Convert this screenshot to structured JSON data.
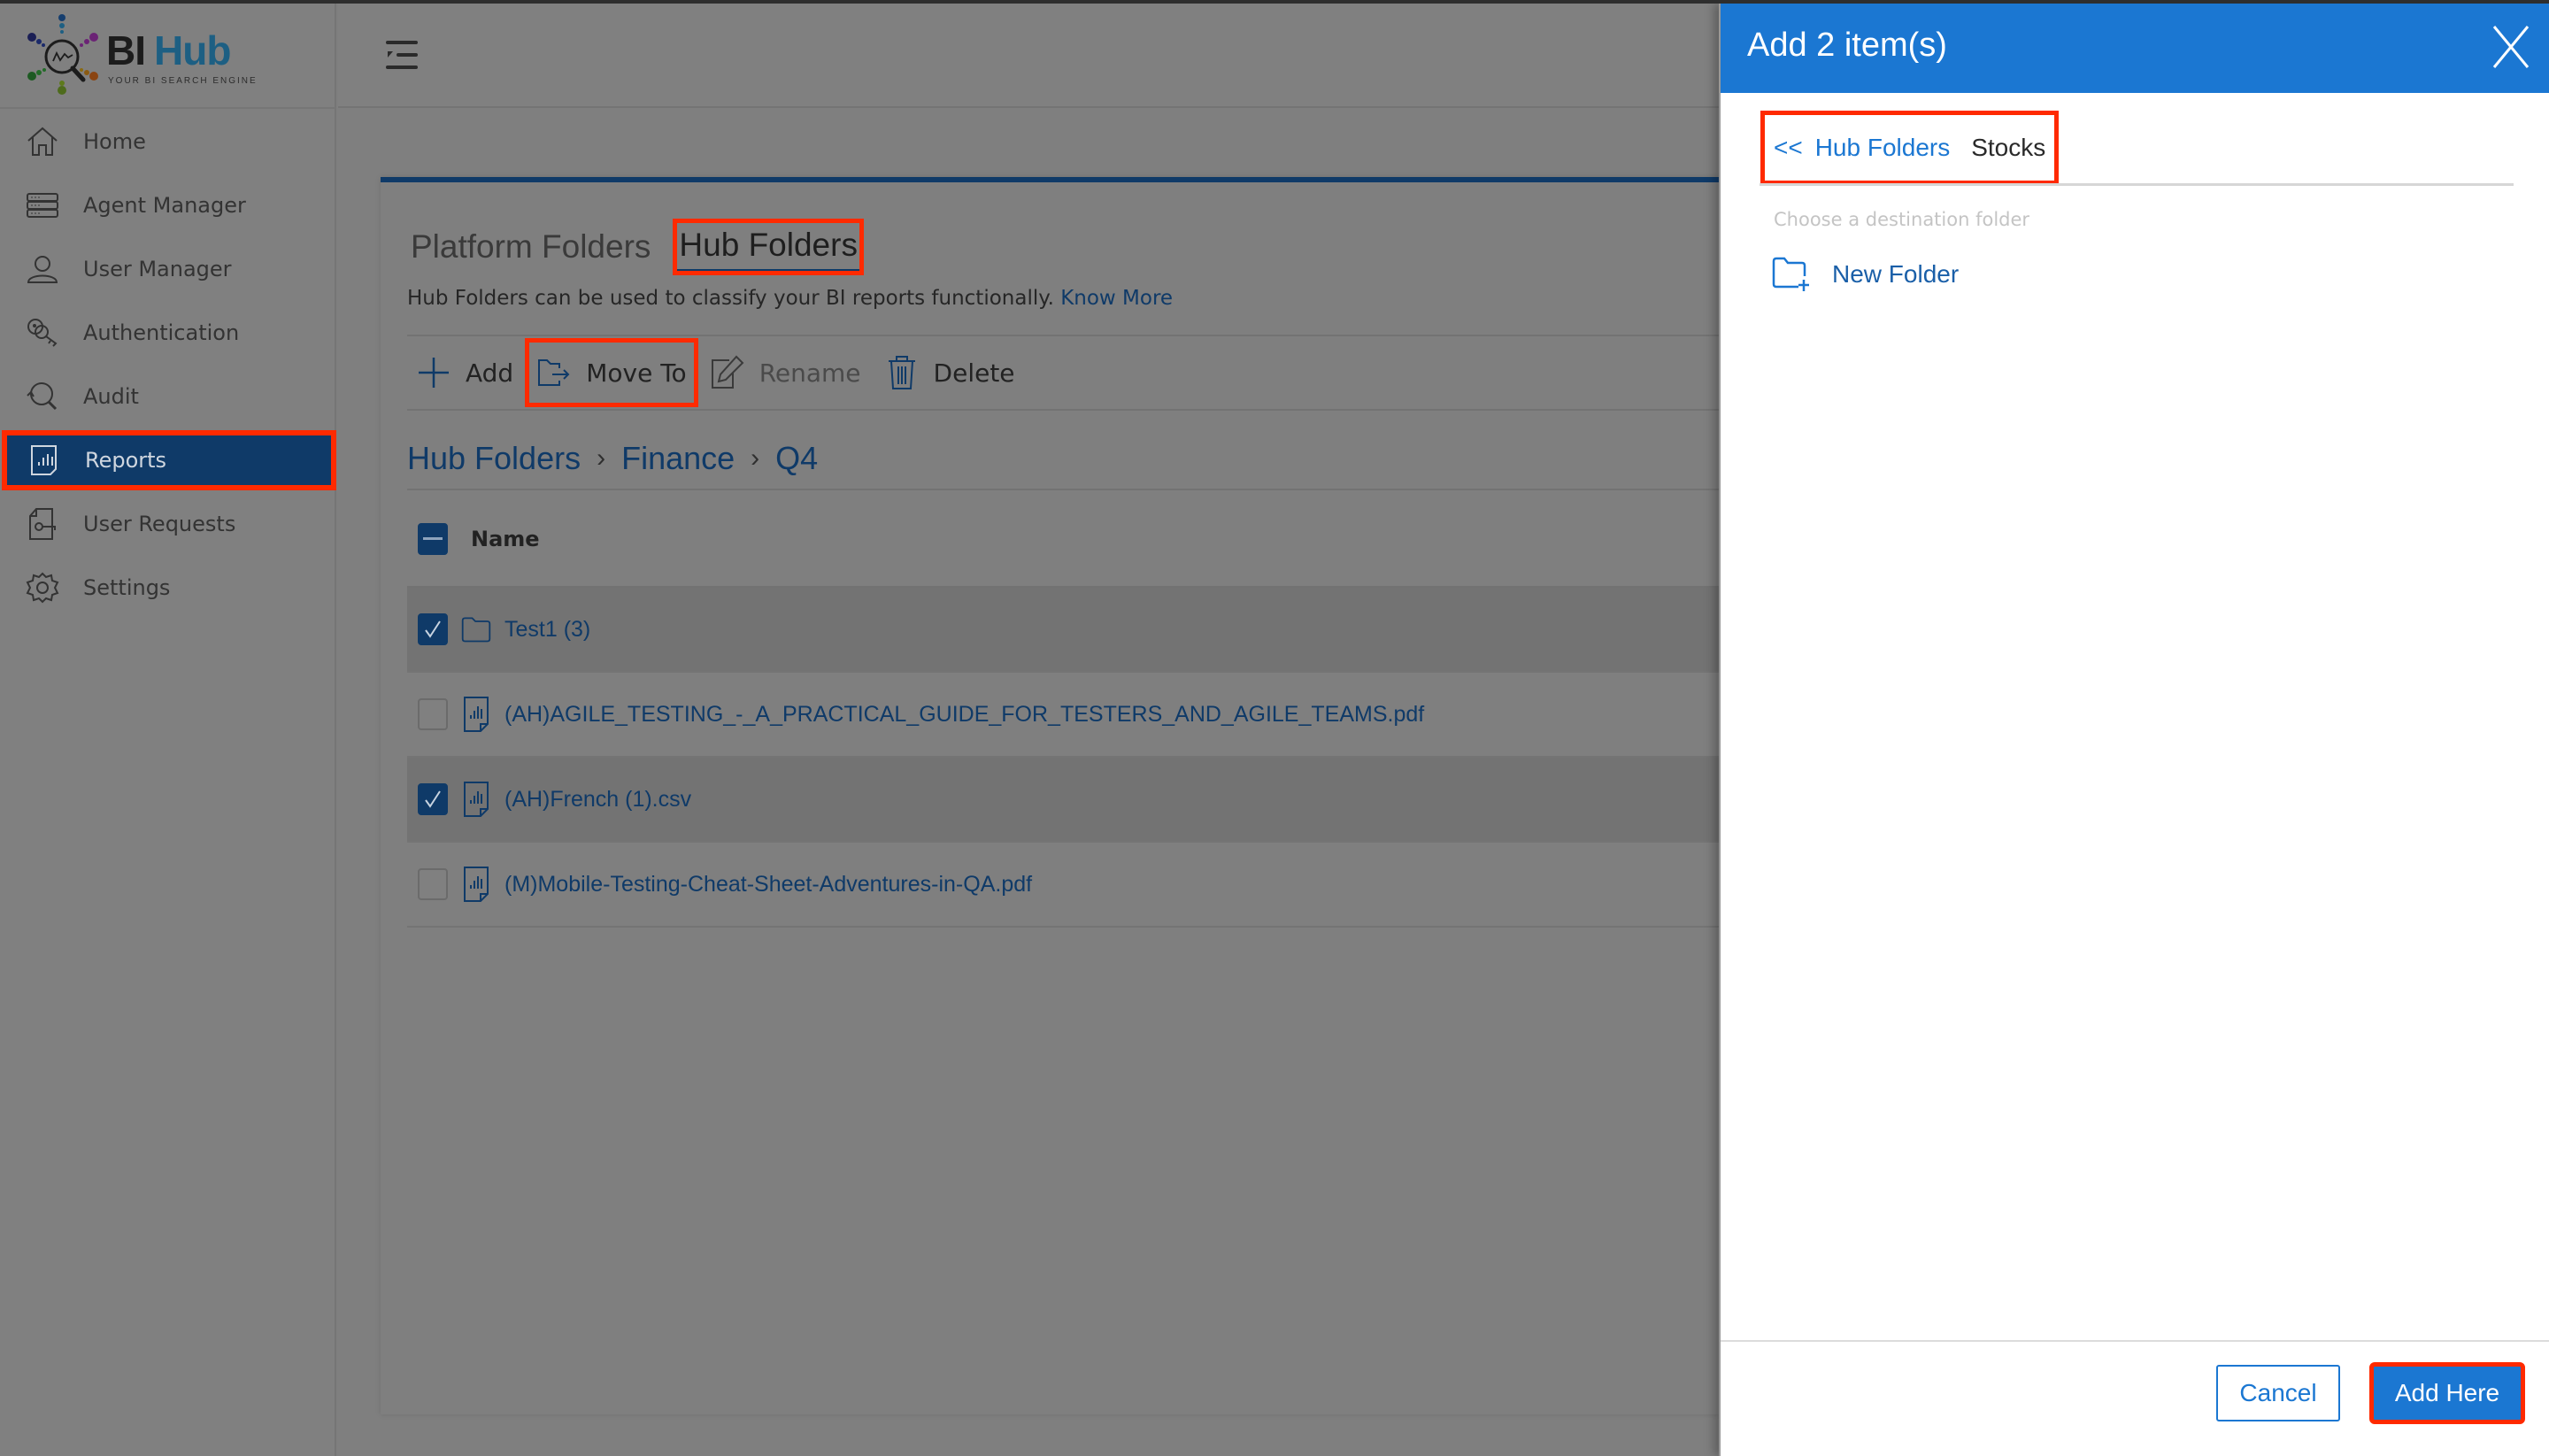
{
  "app": {
    "brand_bi": "BI",
    "brand_hub": "Hub",
    "tagline": "YOUR BI SEARCH ENGINE"
  },
  "sidebar": {
    "items": [
      {
        "label": "Home",
        "icon": "home-icon",
        "active": false
      },
      {
        "label": "Agent Manager",
        "icon": "server-icon",
        "active": false
      },
      {
        "label": "User Manager",
        "icon": "user-icon",
        "active": false
      },
      {
        "label": "Authentication",
        "icon": "keys-icon",
        "active": false
      },
      {
        "label": "Audit",
        "icon": "audit-search-icon",
        "active": false
      },
      {
        "label": "Reports",
        "icon": "report-icon",
        "active": true
      },
      {
        "label": "User Requests",
        "icon": "request-icon",
        "active": false
      },
      {
        "label": "Settings",
        "icon": "gear-icon",
        "active": false
      }
    ]
  },
  "main": {
    "tabs": [
      {
        "label": "Platform Folders",
        "active": false
      },
      {
        "label": "Hub Folders",
        "active": true
      }
    ],
    "description": "Hub Folders can be used to classify your BI reports functionally.",
    "know_more": "Know More",
    "toolbar": {
      "add": "Add",
      "move_to": "Move To",
      "rename": "Rename",
      "delete": "Delete"
    },
    "breadcrumb": [
      "Hub Folders",
      "Finance",
      "Q4"
    ],
    "table": {
      "header": "Name",
      "header_checkbox": "partial",
      "rows": [
        {
          "name": "Test1 (3)",
          "type": "folder",
          "checked": true
        },
        {
          "name": "(AH)AGILE_TESTING_-_A_PRACTICAL_GUIDE_FOR_TESTERS_AND_AGILE_TEAMS.pdf",
          "type": "report",
          "checked": false
        },
        {
          "name": "(AH)French (1).csv",
          "type": "report",
          "checked": true
        },
        {
          "name": "(M)Mobile-Testing-Cheat-Sheet-Adventures-in-QA.pdf",
          "type": "report",
          "checked": false
        }
      ]
    }
  },
  "panel": {
    "title": "Add 2 item(s)",
    "back": "<<",
    "breadcrumb_link": "Hub Folders",
    "breadcrumb_current": "Stocks",
    "hint": "Choose a destination folder",
    "new_folder": "New Folder",
    "cancel": "Cancel",
    "add_here": "Add Here"
  },
  "colors": {
    "accent": "#1b77d2",
    "nav_active": "#0f3a68",
    "highlight": "#ff2a00",
    "overlay_gray": "#7f7f7f"
  }
}
